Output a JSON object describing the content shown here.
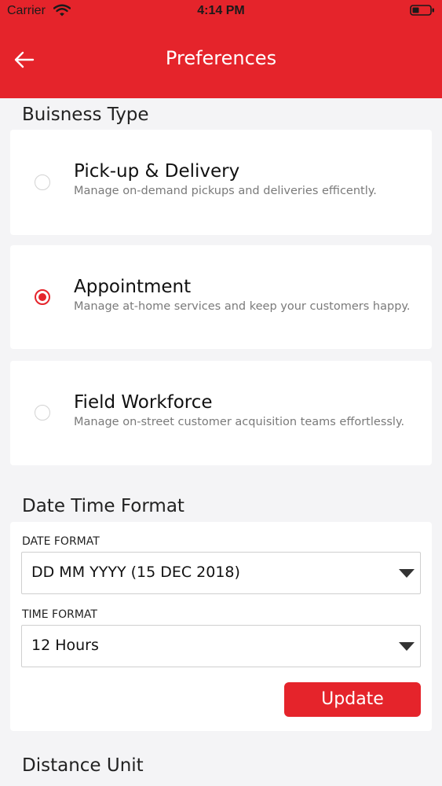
{
  "status_bar": {
    "carrier": "Carrier",
    "time": "4:14 PM"
  },
  "header": {
    "title": "Preferences"
  },
  "business_type": {
    "heading": "Buisness Type",
    "options": [
      {
        "title": "Pick-up & Delivery",
        "description": "Manage on-demand pickups and deliveries efficently.",
        "selected": false
      },
      {
        "title": "Appointment",
        "description": "Manage at-home services and keep your customers happy.",
        "selected": true
      },
      {
        "title": "Field Workforce",
        "description": "Manage on-street customer acquisition teams effortlessly.",
        "selected": false
      }
    ]
  },
  "date_time": {
    "heading": "Date Time Format",
    "date_label": "DATE FORMAT",
    "date_value": "DD MM YYYY (15 DEC 2018)",
    "time_label": "TIME FORMAT",
    "time_value": "12 Hours",
    "update_label": "Update"
  },
  "distance": {
    "heading": "Distance Unit"
  },
  "colors": {
    "accent": "#e5242b",
    "background": "#f4f4f6"
  },
  "icons": {
    "back": "arrow-left-icon",
    "wifi": "wifi-icon",
    "battery": "battery-icon",
    "dropdown": "chevron-down-icon"
  }
}
